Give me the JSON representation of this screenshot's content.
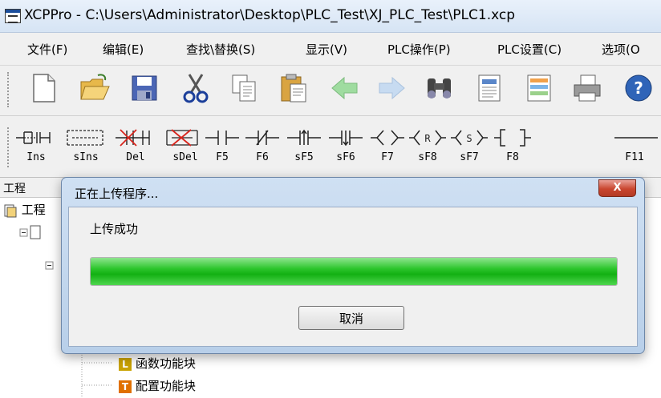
{
  "window": {
    "title": "XCPPro - C:\\Users\\Administrator\\Desktop\\PLC_Test\\XJ_PLC_Test\\PLC1.xcp"
  },
  "menu": [
    {
      "label": "文件(F)"
    },
    {
      "label": "编辑(E)"
    },
    {
      "label": "查找\\替换(S)"
    },
    {
      "label": "显示(V)"
    },
    {
      "label": "PLC操作(P)"
    },
    {
      "label": "PLC设置(C)"
    },
    {
      "label": "选项(O"
    }
  ],
  "toolbar": [
    "new-file-icon",
    "open-folder-icon",
    "save-icon",
    "cut-icon",
    "copy-icon",
    "paste-icon",
    "back-arrow-icon",
    "forward-arrow-icon",
    "find-icon",
    "document-icon",
    "list-icon",
    "print-icon",
    "help-icon"
  ],
  "ladder_tools": [
    {
      "label": "Ins",
      "icon": "insert-row-icon"
    },
    {
      "label": "sIns",
      "icon": "insert-column-icon"
    },
    {
      "label": "Del",
      "icon": "delete-row-icon"
    },
    {
      "label": "sDel",
      "icon": "delete-column-icon"
    },
    {
      "label": "F5",
      "icon": "normally-open-contact-icon"
    },
    {
      "label": "F6",
      "icon": "normally-closed-contact-icon"
    },
    {
      "label": "sF5",
      "icon": "rising-edge-contact-icon"
    },
    {
      "label": "sF6",
      "icon": "falling-edge-contact-icon"
    },
    {
      "label": "F7",
      "icon": "coil-icon"
    },
    {
      "label": "sF8",
      "icon": "reset-coil-icon"
    },
    {
      "label": "sF7",
      "icon": "set-coil-icon"
    },
    {
      "label": "F8",
      "icon": "instruction-bracket-icon"
    },
    {
      "label": "F11",
      "icon": "horizontal-line-icon"
    }
  ],
  "project_panel": {
    "title": "工程",
    "tree_root": "工程",
    "items": [
      {
        "badge": "L",
        "label": "函数功能块",
        "color": "#c9a200"
      },
      {
        "badge": "T",
        "label": "配置功能块",
        "color": "#e07000"
      }
    ]
  },
  "dialog": {
    "title": "正在上传程序...",
    "status": "上传成功",
    "progress": 1.0,
    "cancel_label": "取消",
    "close_label": "X"
  }
}
